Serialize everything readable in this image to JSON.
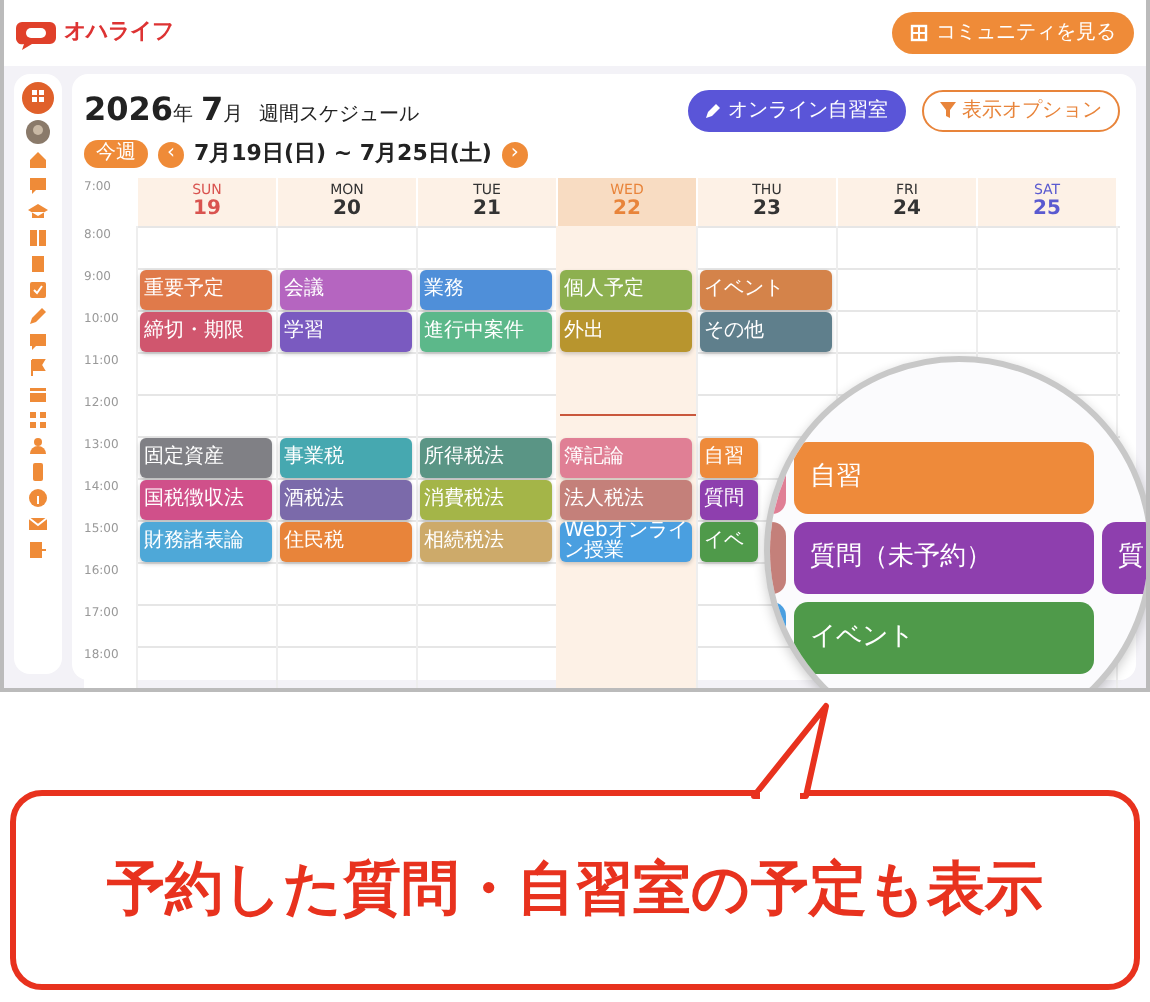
{
  "app": {
    "logo": "オハライフ",
    "community_button": "コミュニティを見る"
  },
  "header": {
    "year": "2026",
    "year_unit": "年",
    "month": "7",
    "month_unit": "月",
    "title": "週間スケジュール",
    "online_button": "オンライン自習室",
    "options_button": "表示オプション",
    "this_week_button": "今週",
    "prev": "‹",
    "next": "›",
    "range": "7月19日(日) ~ 7月25日(土)"
  },
  "calendar": {
    "header_time": "7:00",
    "days": [
      {
        "name": "SUN",
        "date": "19",
        "color": "#d9534f",
        "today": false
      },
      {
        "name": "MON",
        "date": "20",
        "color": "#333333",
        "today": false
      },
      {
        "name": "TUE",
        "date": "21",
        "color": "#333333",
        "today": false
      },
      {
        "name": "WED",
        "date": "22",
        "color": "#e8843a",
        "today": true
      },
      {
        "name": "THU",
        "date": "23",
        "color": "#333333",
        "today": false
      },
      {
        "name": "FRI",
        "date": "24",
        "color": "#333333",
        "today": false
      },
      {
        "name": "SAT",
        "date": "25",
        "color": "#5a5ad0",
        "today": false
      }
    ],
    "hours": [
      {
        "time": "8:00"
      },
      {
        "time": "9:00",
        "events": [
          {
            "label": "重要予定",
            "color": "#e07a4a"
          },
          {
            "label": "会議",
            "color": "#b565c0"
          },
          {
            "label": "業務",
            "color": "#4f8fd9"
          },
          {
            "label": "個人予定",
            "color": "#8db050"
          },
          {
            "label": "イベント",
            "color": "#d4834a"
          }
        ]
      },
      {
        "time": "10:00",
        "events": [
          {
            "label": "締切・期限",
            "color": "#d0566e"
          },
          {
            "label": "学習",
            "color": "#7a5ac0"
          },
          {
            "label": "進行中案件",
            "color": "#5cb88a"
          },
          {
            "label": "外出",
            "color": "#b8952e"
          },
          {
            "label": "その他",
            "color": "#5f7f8c"
          }
        ]
      },
      {
        "time": "11:00"
      },
      {
        "time": "12:00",
        "now": true
      },
      {
        "time": "13:00",
        "events": [
          {
            "label": "固定資産",
            "color": "#808085"
          },
          {
            "label": "事業税",
            "color": "#46a8b0"
          },
          {
            "label": "所得税法",
            "color": "#5a9585"
          },
          {
            "label": "簿記論",
            "color": "#e07f95"
          },
          {
            "label": "自習",
            "color": "#ee8a3a"
          }
        ]
      },
      {
        "time": "14:00",
        "events": [
          {
            "label": "国税徴収法",
            "color": "#d0508a"
          },
          {
            "label": "酒税法",
            "color": "#7b6aaa"
          },
          {
            "label": "消費税法",
            "color": "#a4b548"
          },
          {
            "label": "法人税法",
            "color": "#c4807a"
          },
          {
            "label": "質問",
            "color": "#8e3fae"
          }
        ]
      },
      {
        "time": "15:00",
        "events": [
          {
            "label": "財務諸表論",
            "color": "#4ea8d8"
          },
          {
            "label": "住民税",
            "color": "#e8843a"
          },
          {
            "label": "相続税法",
            "color": "#cdaa6a"
          },
          {
            "label": "Webオンライン授業",
            "color": "#4a9fe0"
          },
          {
            "label": "イベ",
            "color": "#4f9a4a"
          }
        ]
      },
      {
        "time": "16:00"
      },
      {
        "time": "17:00"
      },
      {
        "time": "18:00"
      }
    ]
  },
  "magnifier": {
    "events": [
      {
        "label": "自習",
        "color": "#ee8a3a"
      },
      {
        "label": "質問（未予約）",
        "color": "#8e3fae"
      },
      {
        "label": "質",
        "color": "#8e3fae"
      },
      {
        "label": "イベント",
        "color": "#4f9a4a"
      }
    ]
  },
  "callout": {
    "text": "予約した質問・自習室の予定も表示"
  }
}
